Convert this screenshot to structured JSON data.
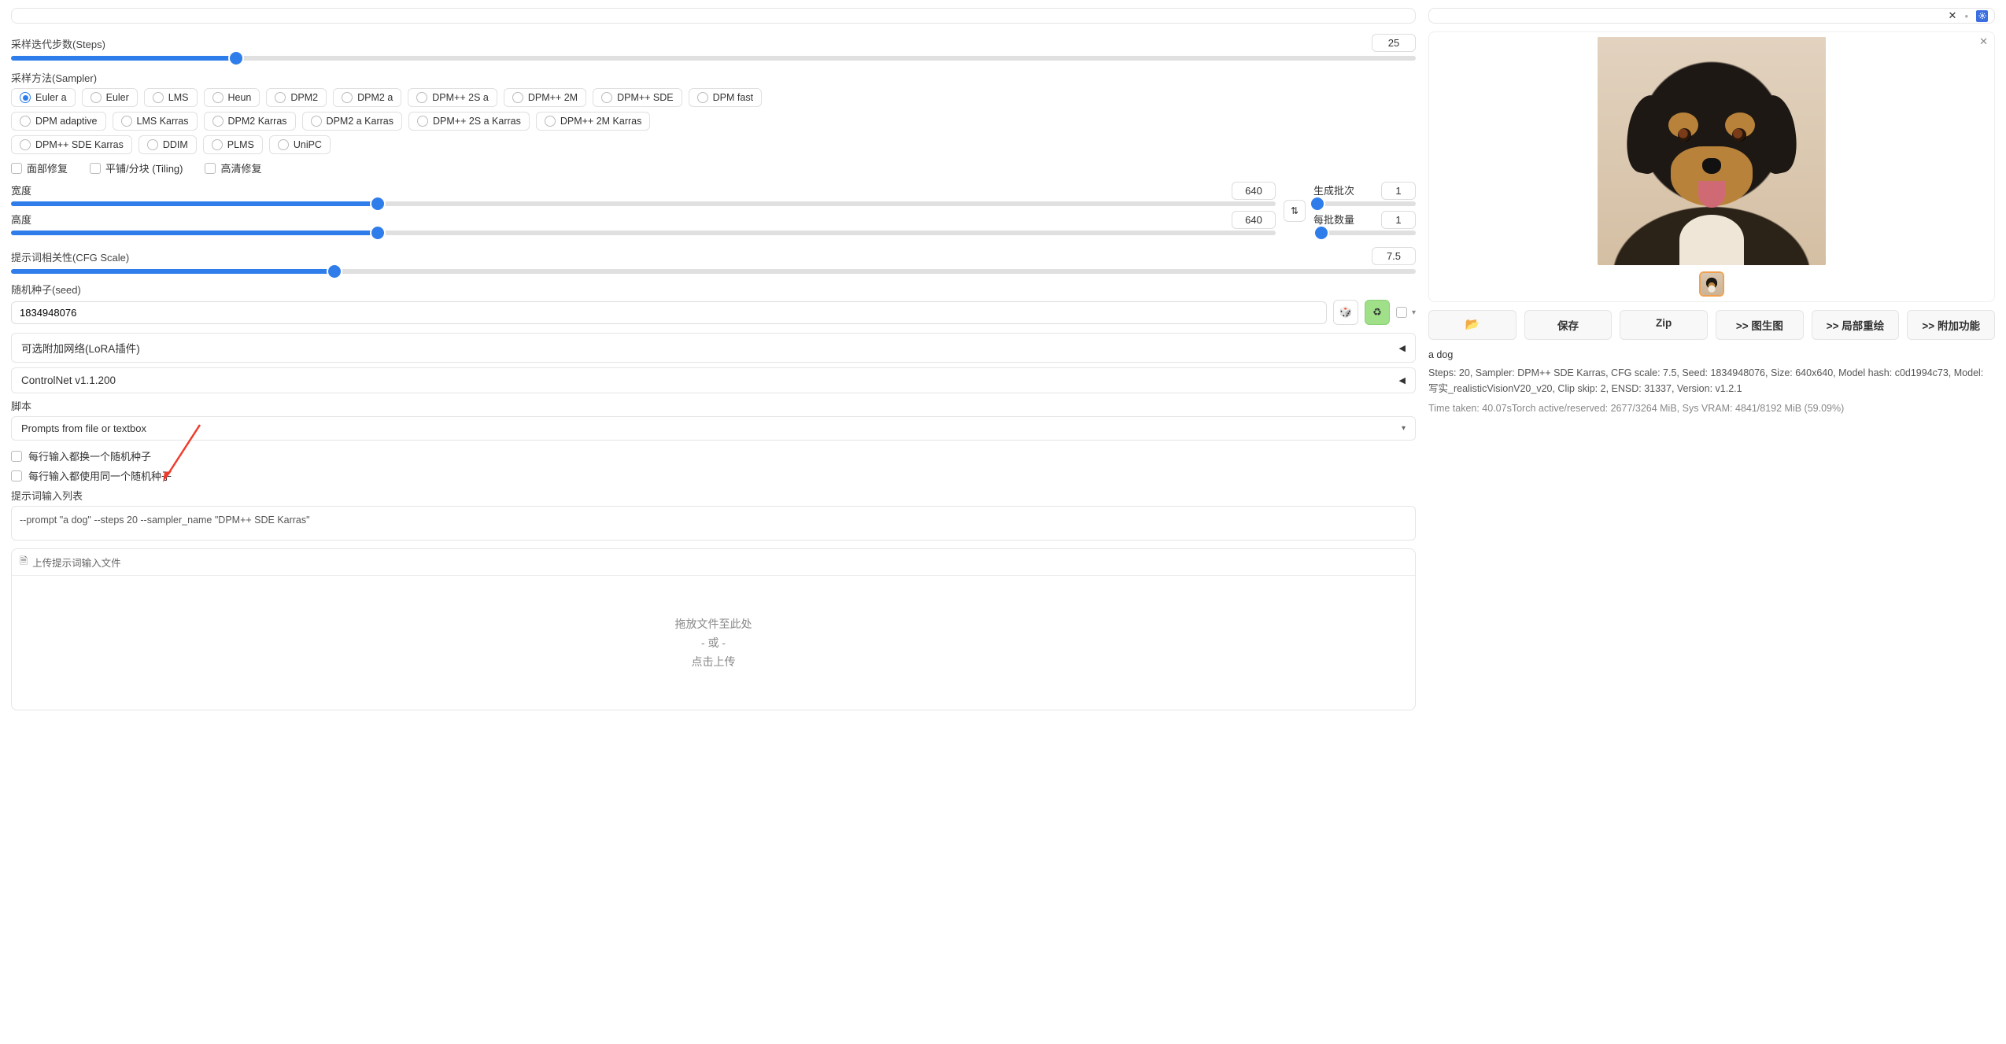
{
  "top_right": {
    "x": "✕",
    "dot": "•"
  },
  "steps": {
    "label": "采样迭代步数(Steps)",
    "value": "25",
    "fill_pct": 16
  },
  "sampler": {
    "label": "采样方法(Sampler)",
    "options_row1": [
      "Euler a",
      "Euler",
      "LMS",
      "Heun",
      "DPM2",
      "DPM2 a",
      "DPM++ 2S a",
      "DPM++ 2M",
      "DPM++ SDE",
      "DPM fast"
    ],
    "options_row2": [
      "DPM adaptive",
      "LMS Karras",
      "DPM2 Karras",
      "DPM2 a Karras",
      "DPM++ 2S a Karras",
      "DPM++ 2M Karras"
    ],
    "options_row3": [
      "DPM++ SDE Karras",
      "DDIM",
      "PLMS",
      "UniPC"
    ],
    "selected": "Euler a"
  },
  "checks": {
    "face": "面部修复",
    "tiling": "平铺/分块 (Tiling)",
    "hires": "高清修复"
  },
  "width": {
    "label": "宽度",
    "value": "640",
    "fill_pct": 29
  },
  "height": {
    "label": "高度",
    "value": "640",
    "fill_pct": 29
  },
  "swap_icon": "⇅",
  "batch_count": {
    "label": "生成批次",
    "value": "1",
    "fill_pct": 4
  },
  "batch_size": {
    "label": "每批数量",
    "value": "1",
    "fill_pct": 8
  },
  "cfg": {
    "label": "提示词相关性(CFG Scale)",
    "value": "7.5",
    "fill_pct": 23
  },
  "seed": {
    "label": "随机种子(seed)",
    "value": "1834948076",
    "dice": "🎲",
    "recycle": "♻",
    "extra_caret": "▾"
  },
  "accordion_lora": "可选附加网络(LoRA插件)",
  "accordion_cnet": "ControlNet v1.1.200",
  "tri": "◀",
  "script_label": "脚本",
  "script_value": "Prompts from file or textbox",
  "script_caret": "▾",
  "chk_rand_each": "每行输入都换一个随机种子",
  "chk_same_seed": "每行输入都使用同一个随机种子",
  "prompt_list_label": "提示词输入列表",
  "prompt_list_value": "--prompt \"a dog\" --steps 20 --sampler_name \"DPM++ SDE Karras\"",
  "upload_tab": "上传提示词输入文件",
  "upload_file_icon": "🗎",
  "drop_line1": "拖放文件至此处",
  "drop_line2": "- 或 -",
  "drop_line3": "点击上传",
  "output": {
    "close": "✕",
    "folder": "📂",
    "save": "保存",
    "zip": "Zip",
    "img2img": ">> 图生图",
    "inpaint": ">> 局部重绘",
    "extras": ">> 附加功能",
    "prompt_line": "a dog",
    "meta_line": "Steps: 20, Sampler: DPM++ SDE Karras, CFG scale: 7.5, Seed: 1834948076, Size: 640x640, Model hash: c0d1994c73, Model: 写实_realisticVisionV20_v20, Clip skip: 2, ENSD: 31337, Version: v1.2.1",
    "time_line": "Time taken: 40.07sTorch active/reserved: 2677/3264 MiB, Sys VRAM: 4841/8192 MiB (59.09%)"
  }
}
